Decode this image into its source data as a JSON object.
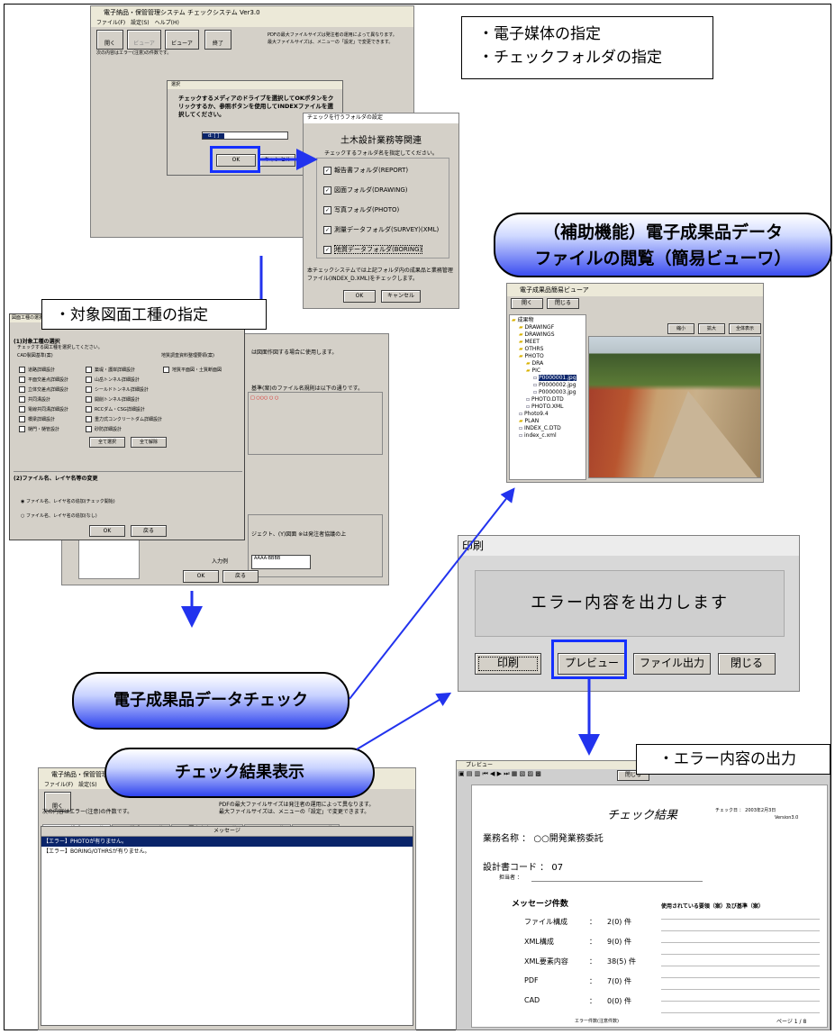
{
  "callouts": {
    "media_line1": "・電子媒体の指定",
    "media_line2": "・チェックフォルダの指定",
    "drawing_type": "・対象図面工種の指定",
    "error_output": "・エラー内容の出力"
  },
  "pills": {
    "viewer_line1": "（補助機能）電子成果品データ",
    "viewer_line2": "ファイルの閲覧（簡易ビューワ）",
    "check": "電子成果品データチェック",
    "result": "チェック結果表示"
  },
  "main_window": {
    "title": "電子納品・保管管理システム チェックシステム Ver3.0",
    "menu": "ファイル(F)　設定(S)　ヘルプ(H)",
    "btn_check": "開く",
    "btn_viewer": "ビューア",
    "btn_close": "終了",
    "pdf_note1": "PDFの最大ファイルサイズは発注者の運用によって異なります。",
    "pdf_note2": "最大ファイルサイズは、メニューの「設定」で変更できます。",
    "status": "次の内容はエラー(注意)の件数です。"
  },
  "select_dialog": {
    "title": "選択",
    "message": "チェックするメディアのドライブを選択してOKボタンをクリックするか、参照ボタンを使用してINDEXファイルを選択してください。",
    "drive": "d: [ ]",
    "ok": "OK",
    "cancel": "キャンセル"
  },
  "folder_dialog": {
    "title": "チェックを行うフォルダの設定",
    "heading": "土木設計業務等関連",
    "sub": "チェックするフォルダ名を指定してください。",
    "items": [
      "報告書フォルダ(REPORT)",
      "図面フォルダ(DRAWING)",
      "写真フォルダ(PHOTO)",
      "測量データフォルダ(SURVEY)(XML)",
      "地質データフォルダ(BORING)"
    ],
    "note": "本チェックシステムでは上記フォルダ内の成果品と業務管理ファイル(INDEX_D.XML)をチェックします。",
    "ok": "OK",
    "cancel": "キャンセル"
  },
  "drawing_dialog": {
    "title": "図面工種の選択",
    "section1": "(1)対象工種の選択",
    "section1_sub": "チェックする図工種を選択してください。",
    "left_head": "CAD製図基準(案)",
    "right_head": "地質調査資料整理要領(案)",
    "items_left": [
      "道路詳細設計",
      "平面交差点詳細設計",
      "立体交差点詳細設計",
      "共同溝設計",
      "電線共同溝詳細設計",
      "橋梁詳細設計",
      "樋門・樋管設計"
    ],
    "items_mid": [
      "築堤・護岸詳細設計",
      "山岳トンネル詳細設計",
      "シールドトンネル詳細設計",
      "開削トンネル詳細設計",
      "RCCダム・CSG詳細設計",
      "重力式コンクリートダム詳細設計",
      "砂防詳細設計"
    ],
    "items_right": [
      "地質平面図・土質断面図"
    ],
    "select_all": "全て選択",
    "clear_all": "全て解除",
    "section2": "(2)ファイル名、レイヤ名等の変更",
    "radio1": "ファイル名、レイヤ名の追加(チェック開始)",
    "radio2": "ファイル名、レイヤ名の追加(なし)",
    "ok": "OK",
    "back": "戻る"
  },
  "behind_dialog": {
    "line1": "は図面作図する場合に使用します。",
    "line2": "基準(案)のファイル名規則は以下の通りです。",
    "line3": "ジェクト、(Y)図面 ※は発注者協議の上",
    "example_label": "入力例",
    "example_value": "AAAA-BBBB",
    "ok": "OK",
    "back": "戻る"
  },
  "viewer": {
    "title": "電子成果品簡易ビューア",
    "open": "開く",
    "close": "閉じる",
    "zoom_out": "縮小",
    "zoom_in": "拡大",
    "fit": "全体表示",
    "tree": [
      "成果物",
      "DRAWINGF",
      "DRAWINGS",
      "MEET",
      "OTHRS",
      "PHOTO",
      "DRA",
      "PIC",
      "P0000001.jpg",
      "P0000002.jpg",
      "P0000003.jpg",
      "PHOTO.DTD",
      "PHOTO.XML",
      "Photo9.4",
      "PLAN",
      "INDEX_C.DTD",
      "index_c.xml"
    ]
  },
  "print_dialog": {
    "title": "印刷",
    "message": "エラー内容を出力します",
    "print": "印刷",
    "preview": "プレビュー",
    "file_out": "ファイル出力",
    "close": "閉じる"
  },
  "result_window": {
    "title": "電子納品・保管管理システム",
    "menu": "ファイル(F)　設定(S)",
    "tabs": [
      "ファイル構成: 2 (0) 件",
      "XML構成: 9 (0) 件",
      "XML要素内容: 38 (5) 件",
      "PDF: 7 (0) 件",
      "CAD: 0 (0) 件"
    ],
    "column": "メッセージ",
    "rows": [
      "【エラー】PHOTOが有りません。",
      "【エラー】BORING/OTHRSが有りません。"
    ]
  },
  "preview": {
    "title": "プレビュー",
    "close_btn": "閉じる",
    "heading": "チェック結果",
    "check_date": "チェック日 ： 2003年2月3日",
    "version": "Version3.0",
    "project": "業務名称 ： ○○開発業務委託",
    "code": "設計書コード ： 07",
    "reporter": "担当者 ：",
    "count_head": "メッセージ件数",
    "counts": [
      {
        "label": "ファイル構成",
        "value": "2(0) 件"
      },
      {
        "label": "XML構成",
        "value": "9(0) 件"
      },
      {
        "label": "XML要素内容",
        "value": "38(5) 件"
      },
      {
        "label": "PDF",
        "value": "7(0) 件"
      },
      {
        "label": "CAD",
        "value": "0(0) 件"
      }
    ],
    "count_foot": "エラー件数(注意件数)",
    "standards_head": "使用されている要領（案）及び基準（案）",
    "page": "ページ 1 / 8"
  },
  "colors": {
    "accent_blue": "#1530ff",
    "arrow_blue": "#2233ee",
    "win_gray": "#d4d0c8",
    "title_blue": "#0a246a"
  }
}
